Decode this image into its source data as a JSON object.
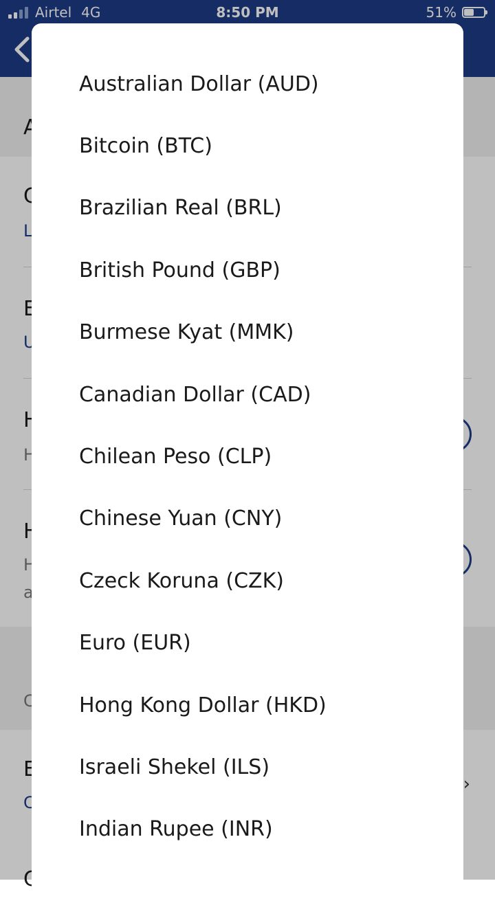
{
  "status_bar": {
    "carrier": "Airtel",
    "network": "4G",
    "time": "8:50 PM",
    "battery_percent": "51%",
    "battery_level": 0.51
  },
  "header": {
    "back_icon": "chevron-left-icon"
  },
  "background_fragments": {
    "row1": "A",
    "row2_title": "C",
    "row2_sub": "L",
    "row3_title": "E",
    "row3_sub": "U",
    "row4_title": "H",
    "row4_sub": "H",
    "row5_title": "H",
    "row5_sub": "H",
    "row5_sub2": "a",
    "row6": "C",
    "row7_title": "E",
    "row7_sub": "C",
    "row8_title": "C"
  },
  "currency_options": [
    {
      "label": "Australian Dollar (AUD)"
    },
    {
      "label": "Bitcoin (BTC)"
    },
    {
      "label": "Brazilian Real (BRL)"
    },
    {
      "label": "British Pound (GBP)"
    },
    {
      "label": "Burmese Kyat (MMK)"
    },
    {
      "label": "Canadian Dollar (CAD)"
    },
    {
      "label": "Chilean Peso (CLP)"
    },
    {
      "label": "Chinese Yuan (CNY)"
    },
    {
      "label": "Czeck Koruna (CZK)"
    },
    {
      "label": "Euro (EUR)"
    },
    {
      "label": "Hong Kong Dollar (HKD)"
    },
    {
      "label": "Israeli Shekel (ILS)"
    },
    {
      "label": "Indian Rupee (INR)"
    }
  ],
  "colors": {
    "brand_blue": "#1c3d86",
    "text": "#1a1a1a"
  }
}
